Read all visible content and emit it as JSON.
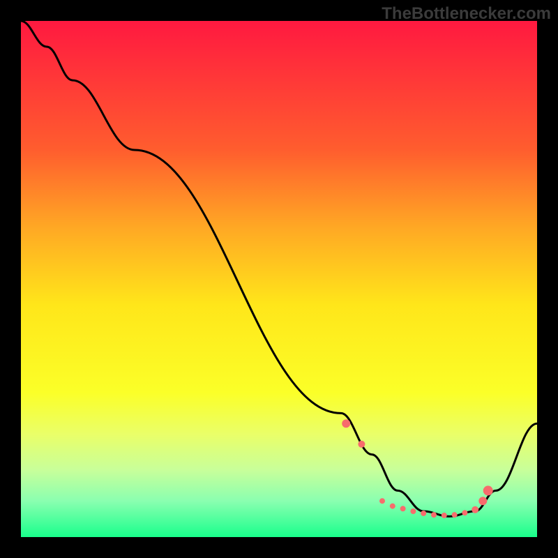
{
  "watermark": "TheBottlenecker.com",
  "chart_data": {
    "type": "line",
    "title": "",
    "xlabel": "",
    "ylabel": "",
    "xlim": [
      0,
      100
    ],
    "ylim": [
      0,
      100
    ],
    "gradient_stops": [
      {
        "offset": 0,
        "color": "#ff1940"
      },
      {
        "offset": 25,
        "color": "#ff5d2e"
      },
      {
        "offset": 40,
        "color": "#ffa824"
      },
      {
        "offset": 55,
        "color": "#ffe61a"
      },
      {
        "offset": 72,
        "color": "#fbff28"
      },
      {
        "offset": 80,
        "color": "#eaff68"
      },
      {
        "offset": 87,
        "color": "#c8ff9a"
      },
      {
        "offset": 93,
        "color": "#8affb0"
      },
      {
        "offset": 100,
        "color": "#19ff8c"
      }
    ],
    "series": [
      {
        "name": "curve",
        "x": [
          0,
          5,
          10,
          22,
          62,
          68,
          73,
          78,
          83,
          88,
          92,
          100
        ],
        "y": [
          100,
          95,
          88.5,
          75,
          24,
          16,
          9,
          5,
          4,
          5,
          9,
          22
        ]
      }
    ],
    "markers": {
      "name": "points",
      "x": [
        63,
        66,
        70,
        72,
        74,
        76,
        78,
        80,
        82,
        84,
        86,
        88,
        89.5,
        90.5
      ],
      "y": [
        22,
        18,
        7,
        6,
        5.5,
        5,
        4.6,
        4.3,
        4.2,
        4.3,
        4.7,
        5.3,
        7,
        9
      ],
      "sizes": [
        6,
        5,
        4,
        4,
        4,
        4,
        4,
        4,
        4,
        4,
        4,
        5,
        6,
        7
      ],
      "color": "#f76c6c"
    }
  }
}
